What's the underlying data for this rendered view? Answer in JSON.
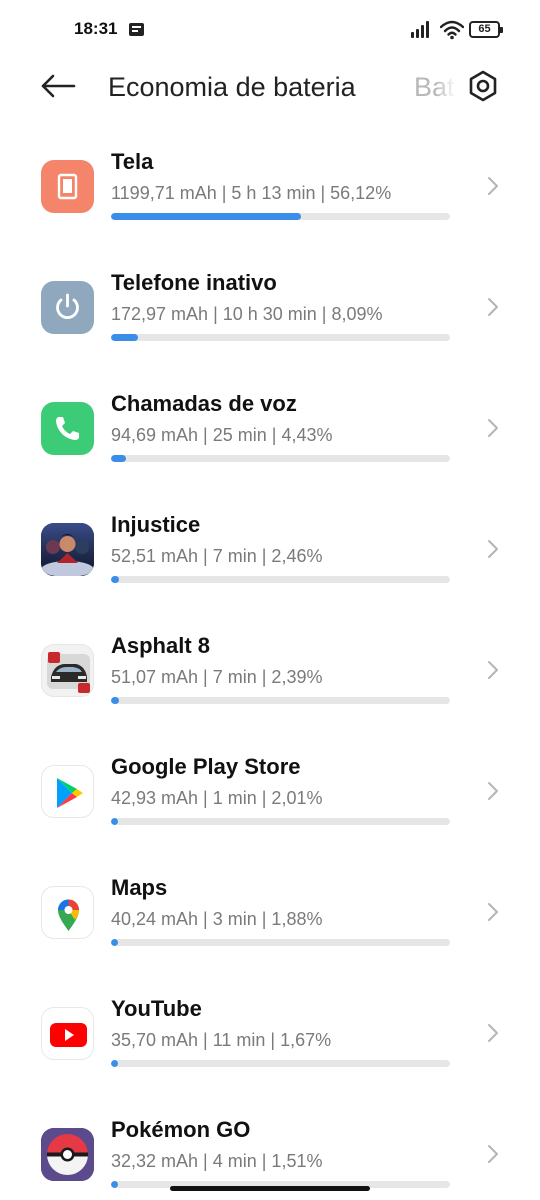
{
  "status_bar": {
    "time": "18:31",
    "battery_level": "65",
    "icons": [
      "message-icon",
      "signal-icon",
      "wifi-icon",
      "battery-icon"
    ]
  },
  "header": {
    "back_icon": "arrow-left-icon",
    "title": "Economia de bateria",
    "next_tab": "Bat",
    "settings_icon": "gear-icon"
  },
  "colors": {
    "bar_fill": "#3b8ee8",
    "bar_track": "#e6e6e6",
    "tela_icon_bg": "#f4846a",
    "inativo_icon_bg": "#8fa8bd",
    "chamadas_icon_bg": "#3ccc77"
  },
  "items": [
    {
      "name": "Tela",
      "detail": "1199,71 mAh | 5 h 13 min  | 56,12%",
      "share": 0.5612,
      "icon": "screen-icon"
    },
    {
      "name": "Telefone inativo",
      "detail": "172,97 mAh | 10 h 30 min  | 8,09%",
      "share": 0.0809,
      "icon": "power-icon"
    },
    {
      "name": "Chamadas de voz",
      "detail": "94,69 mAh | 25 min  | 4,43%",
      "share": 0.0443,
      "icon": "phone-icon"
    },
    {
      "name": "Injustice",
      "detail": "52,51 mAh | 7 min  | 2,46%",
      "share": 0.0246,
      "icon": "injustice-app-icon"
    },
    {
      "name": "Asphalt 8",
      "detail": "51,07 mAh | 7 min  | 2,39%",
      "share": 0.0239,
      "icon": "asphalt-app-icon"
    },
    {
      "name": "Google Play Store",
      "detail": "42,93 mAh | 1 min  | 2,01%",
      "share": 0.0201,
      "icon": "play-store-icon"
    },
    {
      "name": "Maps",
      "detail": "40,24 mAh | 3 min  | 1,88%",
      "share": 0.0188,
      "icon": "maps-icon"
    },
    {
      "name": "YouTube",
      "detail": "35,70 mAh | 11 min  | 1,67%",
      "share": 0.0167,
      "icon": "youtube-icon"
    },
    {
      "name": "Pokémon GO",
      "detail": "32,32 mAh | 4 min  | 1,51%",
      "share": 0.0151,
      "icon": "pokemon-go-icon"
    }
  ]
}
